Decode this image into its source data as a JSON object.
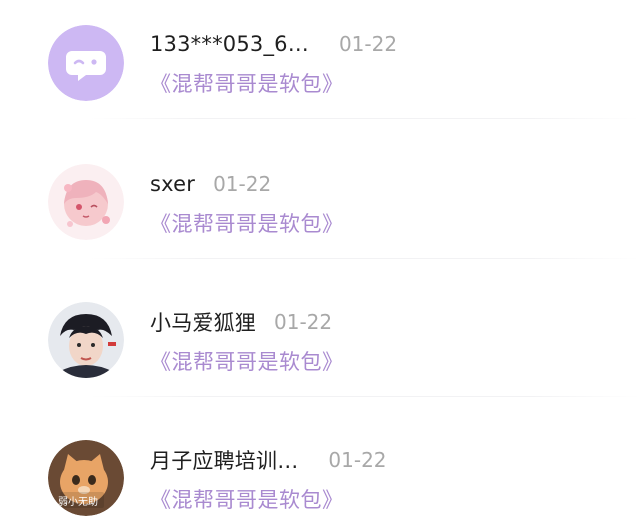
{
  "comments": [
    {
      "user": "133***053_6…",
      "time": "01-22",
      "work": "《混帮哥哥是软包》",
      "avatar": "default-chat-bubble-avatar",
      "avatar_color": "#cdb8f3"
    },
    {
      "user": "sxer",
      "time": "01-22",
      "work": "《混帮哥哥是软包》",
      "avatar": "anime-girl-avatar",
      "avatar_color": "#f6d9dc"
    },
    {
      "user": "小马爱狐狸",
      "time": "01-22",
      "work": "《混帮哥哥是软包》",
      "avatar": "portrait-boy-avatar",
      "avatar_color": "#dfe2e6"
    },
    {
      "user": "月子应聘培训…",
      "time": "01-22",
      "work": "《混帮哥哥是软包》",
      "avatar": "cat-photo-avatar",
      "avatar_color": "#e8a466",
      "avatar_caption": "弱小无助"
    }
  ],
  "colors": {
    "name": "#1f1f1f",
    "time": "#a8a8a8",
    "work_link": "#a98ad0",
    "divider": "#f2f2f4"
  }
}
